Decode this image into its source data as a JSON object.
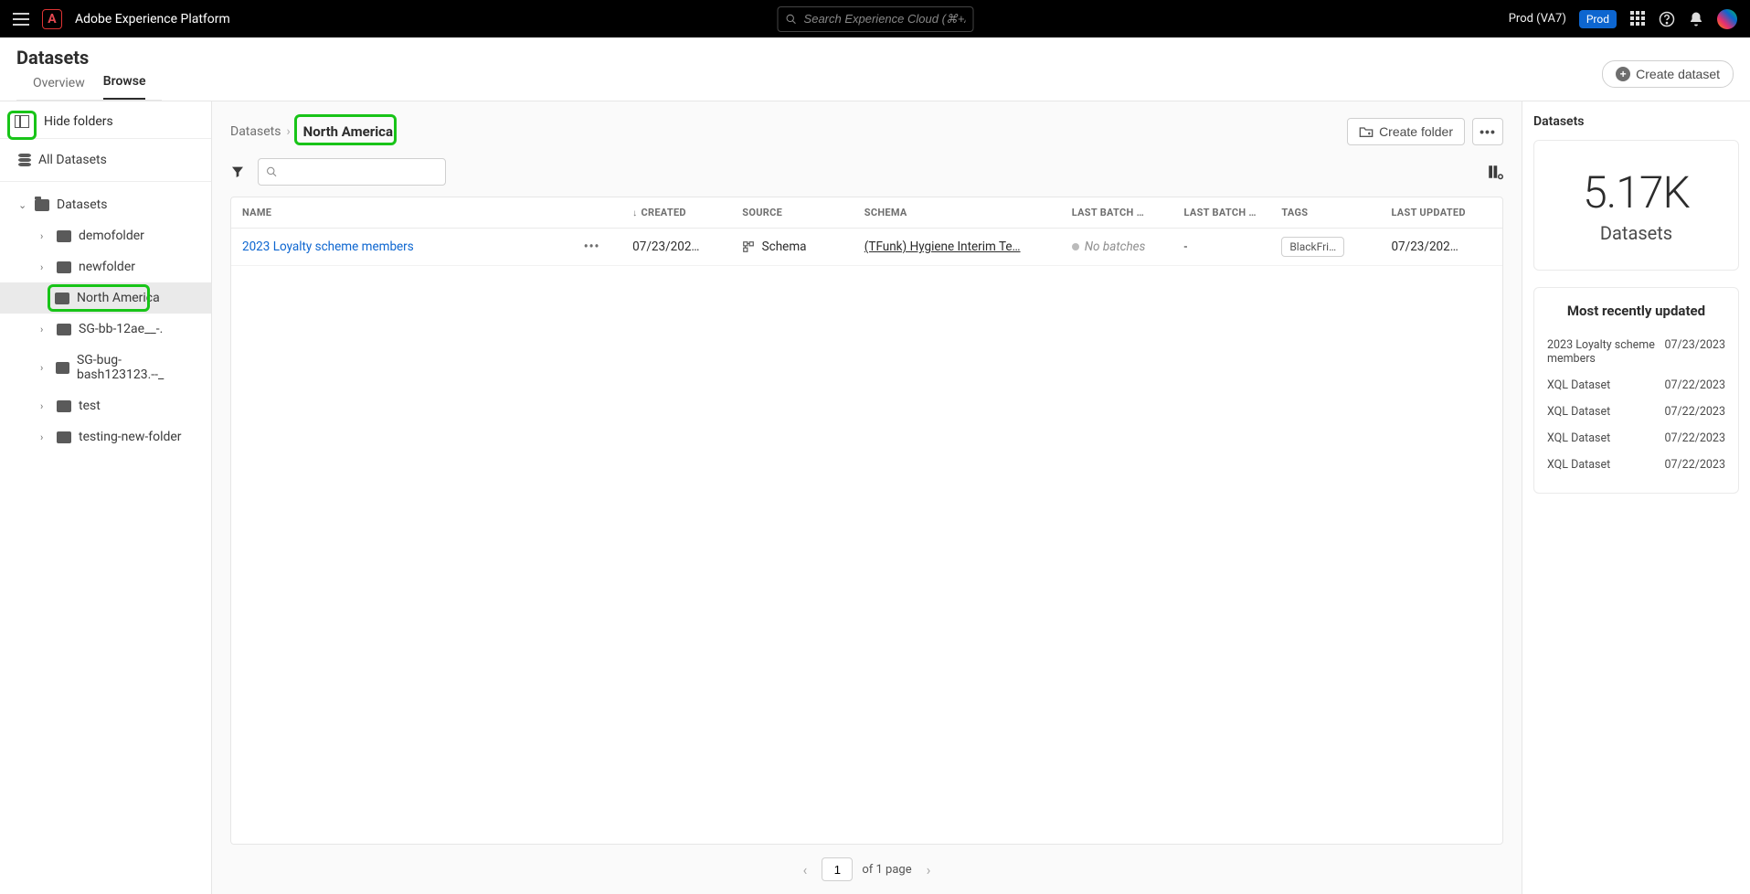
{
  "topbar": {
    "app_name": "Adobe Experience Platform",
    "search_placeholder": "Search Experience Cloud (⌘+/)",
    "org_name": "Prod (VA7)",
    "env_badge": "Prod"
  },
  "page": {
    "title": "Datasets",
    "create_btn": "Create dataset"
  },
  "tabs": {
    "overview": "Overview",
    "browse": "Browse"
  },
  "sidebar": {
    "hide_folders": "Hide folders",
    "all_datasets": "All Datasets",
    "root": "Datasets",
    "folders": {
      "demofolder": "demofolder",
      "newfolder": "newfolder",
      "north_america": "North America",
      "sg_bb": "SG-bb-12ae__-.",
      "sg_bug": "SG-bug-bash123123.--_",
      "test": "test",
      "testing_new": "testing-new-folder"
    }
  },
  "breadcrumb": {
    "root": "Datasets",
    "current": "North America"
  },
  "actions": {
    "create_folder": "Create folder"
  },
  "columns": {
    "name": "NAME",
    "created": "CREATED",
    "source": "SOURCE",
    "schema": "SCHEMA",
    "last_batch_status": "LAST BATCH …",
    "last_batch_id": "LAST BATCH …",
    "tags": "TAGS",
    "last_updated": "LAST UPDATED"
  },
  "rows": [
    {
      "name": "2023 Loyalty scheme members",
      "created": "07/23/202…",
      "source": "Schema",
      "schema": "(TFunk) Hygiene Interim Te…",
      "last_batch_status": "No batches",
      "last_batch_id": "-",
      "tag": "BlackFri…",
      "last_updated": "07/23/202…"
    }
  ],
  "pager": {
    "page": "1",
    "of_text": "of 1 page"
  },
  "right": {
    "title": "Datasets",
    "stat_num": "5.17K",
    "stat_label": "Datasets",
    "recent_title": "Most recently updated",
    "recent": [
      {
        "name": "2023 Loyalty scheme members",
        "date": "07/23/2023"
      },
      {
        "name": "XQL Dataset",
        "date": "07/22/2023"
      },
      {
        "name": "XQL Dataset",
        "date": "07/22/2023"
      },
      {
        "name": "XQL Dataset",
        "date": "07/22/2023"
      },
      {
        "name": "XQL Dataset",
        "date": "07/22/2023"
      }
    ]
  }
}
